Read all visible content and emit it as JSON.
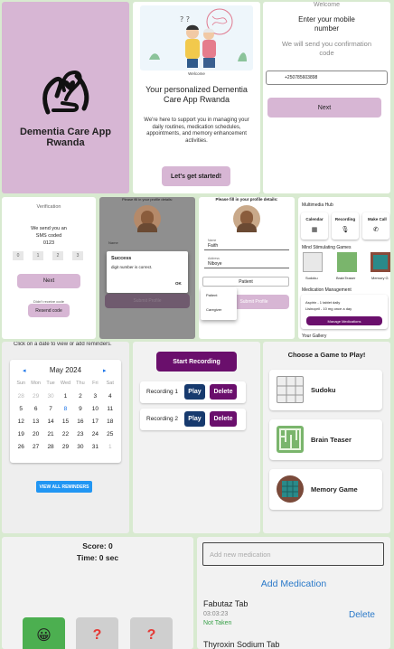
{
  "splash": {
    "app_name": "Dementia Care App Rwanda"
  },
  "welcome": {
    "caption": "Welcome",
    "heading": "Your personalized Dementia Care App Rwanda",
    "body": "We're here to support you in managing your daily routines, medication schedules, appointments, and memory enhancement activities.",
    "cta": "Let's get started!"
  },
  "phone": {
    "header": "Welcome",
    "title": "Enter your mobile number",
    "subtitle": "We will send you confirmation code",
    "value": "+250785603898",
    "next": "Next"
  },
  "verify": {
    "title": "Verification",
    "line1": "We send you an",
    "line2": "SMS coded",
    "code": "0123",
    "boxes": [
      "0",
      "1",
      "2",
      "3"
    ],
    "next": "Next",
    "didnt": "Didn't receive code",
    "resend": "Resend code"
  },
  "success_dialog": {
    "header": "Please fill in your profile details:",
    "field_label": "Name",
    "title": "Success",
    "message": "digit number is correct.",
    "ok": "OK",
    "submit": "Submit Profile"
  },
  "profile": {
    "header": "Please fill in your profile details:",
    "name_label": "Name",
    "name_value": "Faith",
    "address_label": "Address",
    "address_value": "Niboye",
    "role_value": "Patient",
    "options": [
      "Patient",
      "Caregiver"
    ],
    "submit": "Submit Profile"
  },
  "hub": {
    "title": "Multimedia Hub",
    "tiles": [
      "Calendar",
      "Recording",
      "Make Call"
    ],
    "games_title": "Mind Stimulating Games",
    "games": [
      "Sudoku",
      "BrainTeaser",
      "Memory G"
    ],
    "med_title": "Medication Management",
    "med_line1": "Aspirin - 1 tablet daily",
    "med_line2": "Lisinopril - 10 mg once a day",
    "med_button": "Manage Medications",
    "gallery": "Your Gallery"
  },
  "calendar": {
    "hint": "Click on a date to view or add reminders.",
    "month": "May 2024",
    "weekdays": [
      "Sun",
      "Mon",
      "Tue",
      "Wed",
      "Thu",
      "Fri",
      "Sat"
    ],
    "weeks": [
      [
        "28",
        "29",
        "30",
        "1",
        "2",
        "3",
        "4"
      ],
      [
        "5",
        "6",
        "7",
        "8",
        "9",
        "10",
        "11"
      ],
      [
        "12",
        "13",
        "14",
        "15",
        "16",
        "17",
        "18"
      ],
      [
        "19",
        "20",
        "21",
        "22",
        "23",
        "24",
        "25"
      ],
      [
        "26",
        "27",
        "28",
        "29",
        "30",
        "31",
        "1"
      ]
    ],
    "button": "VIEW ALL REMINDERS"
  },
  "recordings": {
    "start": "Start Recording",
    "items": [
      {
        "label": "Recording 1",
        "play": "Play",
        "delete": "Delete"
      },
      {
        "label": "Recording 2",
        "play": "Play",
        "delete": "Delete"
      }
    ]
  },
  "games_screen": {
    "title": "Choose a Game to Play!",
    "games": [
      "Sudoku",
      "Brain Teaser",
      "Memory Game"
    ]
  },
  "memory_game": {
    "score": "Score: 0",
    "time": "Time: 0 sec",
    "cards": [
      "😀",
      "?",
      "?"
    ]
  },
  "medications": {
    "placeholder": "Add new medication",
    "add": "Add Medication",
    "items": [
      {
        "name": "Fabutaz Tab",
        "time": "03:03:23",
        "status": "Not Taken",
        "delete": "Delete"
      },
      {
        "name": "Thyroxin Sodium Tab"
      }
    ]
  },
  "colors": {
    "lavender": "#d7b6d4",
    "dark_purple": "#6a0f6c",
    "navy": "#173a6e",
    "link_blue": "#2a79c9",
    "status_green": "#3aa14a",
    "background_green": "#d8ead0"
  }
}
